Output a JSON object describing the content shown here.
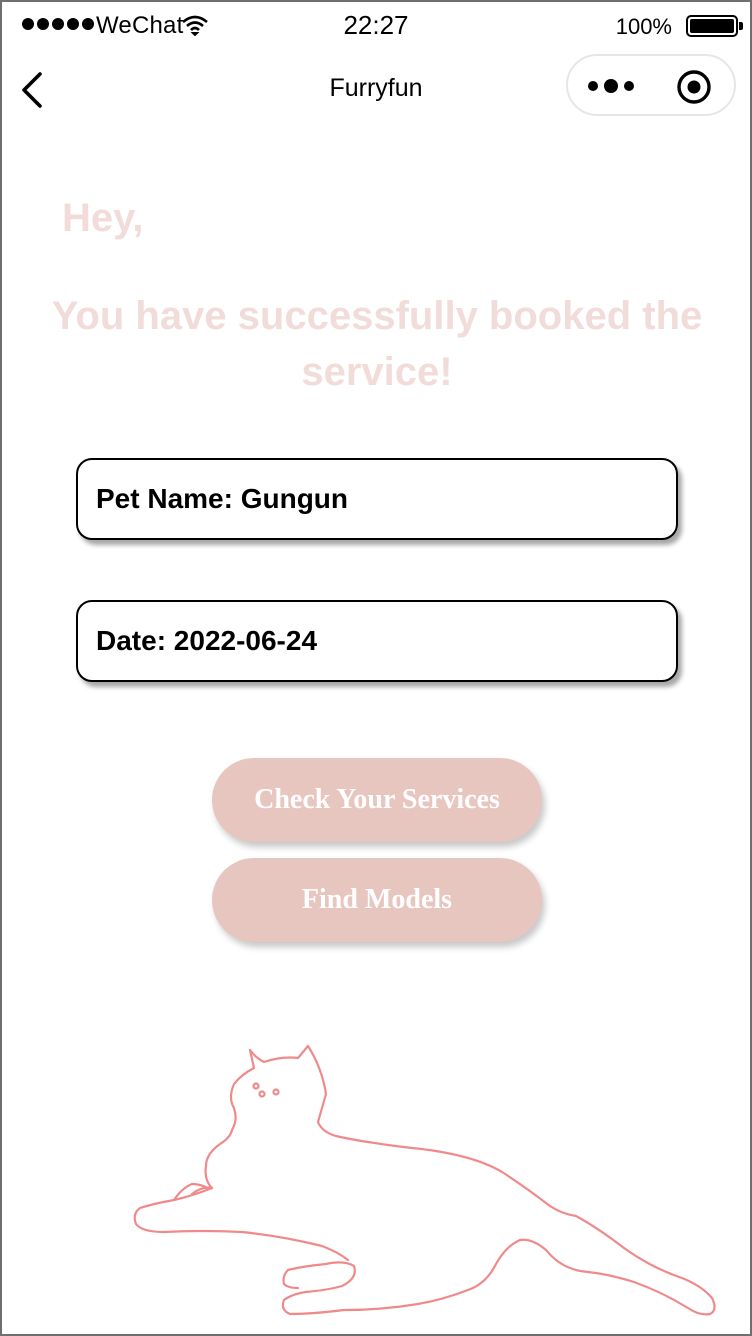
{
  "status_bar": {
    "carrier": "WeChat",
    "time": "22:27",
    "battery_percent": "100%",
    "battery_level": 1.0
  },
  "nav": {
    "title": "Furryfun",
    "icons": [
      "back-chevron-icon",
      "more-dots-icon",
      "target-circle-icon"
    ]
  },
  "content": {
    "greeting": "Hey,",
    "message": "You have successfully booked the service!",
    "pet_name": "Pet Name: Gungun",
    "date": "Date: 2022-06-24"
  },
  "buttons": {
    "check_services": "Check Your Services",
    "find_models": "Find Models"
  },
  "illustration": {
    "icon": "cat-outline-icon",
    "stroke_color": "#f08a8a"
  },
  "colors": {
    "heading_text": "#f1dcda",
    "button_bg": "#e8c6c0",
    "button_text": "#ffffff",
    "card_border": "#000000"
  }
}
